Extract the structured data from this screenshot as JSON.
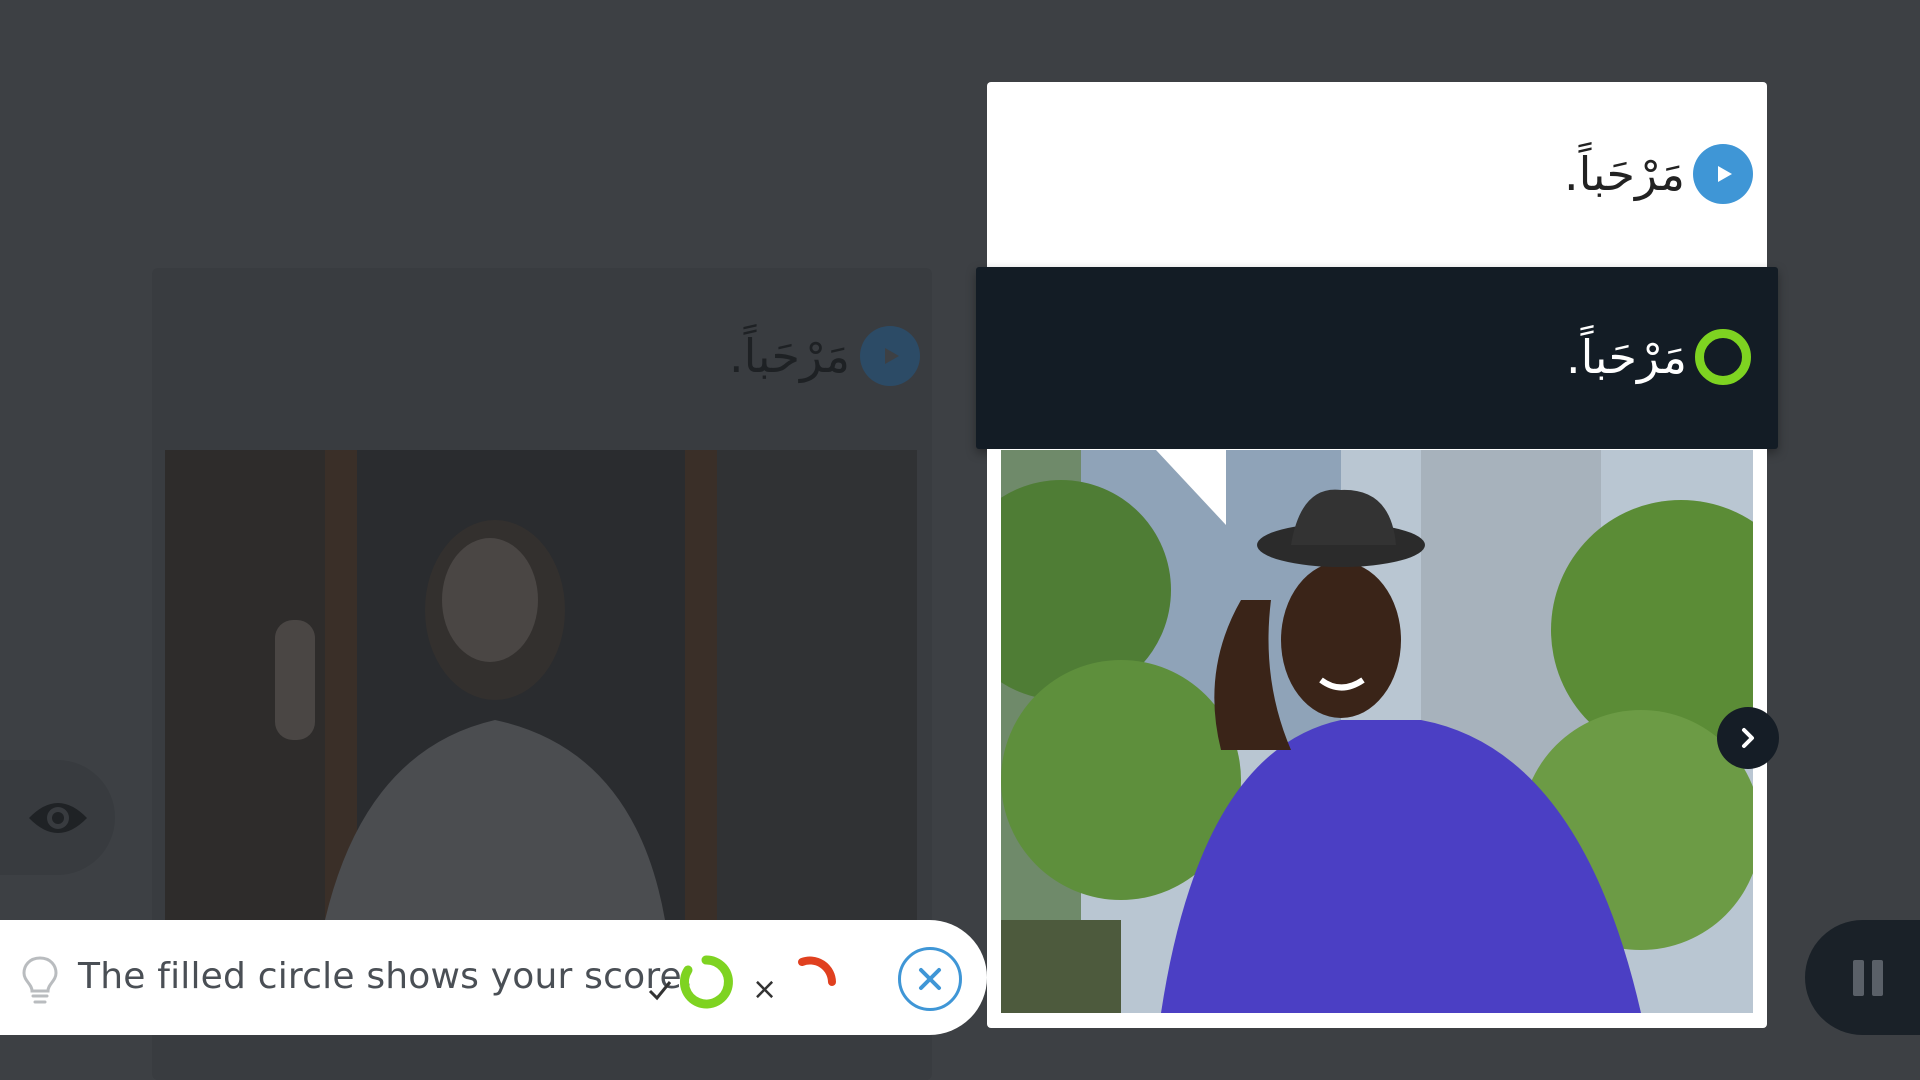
{
  "previous_card": {
    "phrase": "مَرْحَباً."
  },
  "current_card": {
    "prompt_phrase": "مَرْحَباً.",
    "answer_phrase": "مَرْحَباً."
  },
  "tip": {
    "text": "The filled circle shows your score.",
    "correct_symbol": "✓",
    "incorrect_symbol": "×"
  },
  "colors": {
    "background": "#3d4044",
    "accent_blue": "#3f96d6",
    "correct_green": "#7ed321",
    "incorrect_red": "#e0401f",
    "answer_bar": "#131c25"
  },
  "icons": {
    "eye": "eye-icon",
    "play": "play-icon",
    "next": "chevron-right-icon",
    "bulb": "lightbulb-icon",
    "close": "close-icon",
    "pause": "pause-icon"
  }
}
